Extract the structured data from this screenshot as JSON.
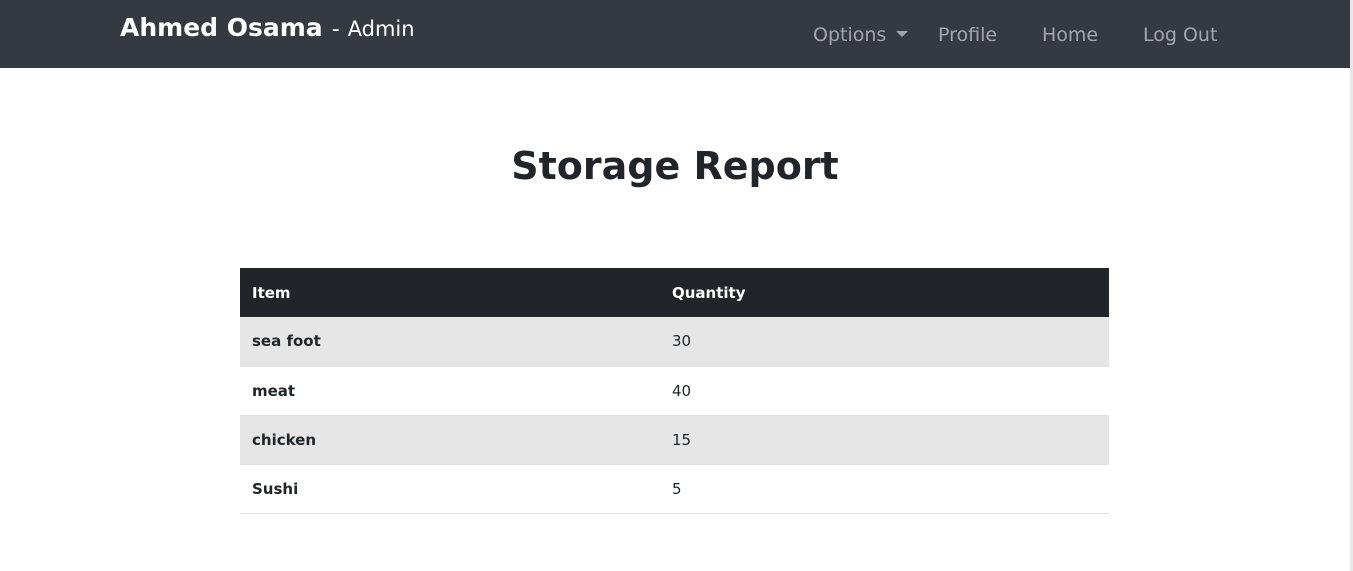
{
  "navbar": {
    "brand_name": "Ahmed Osama",
    "brand_separator": "-",
    "brand_role": "Admin",
    "options_label": "Options",
    "profile_label": "Profile",
    "home_label": "Home",
    "logout_label": "Log Out",
    "background_color": "#343a40"
  },
  "main": {
    "title": "Storage Report",
    "table": {
      "headers": [
        "Item",
        "Quantity"
      ],
      "rows": [
        {
          "item": "sea foot",
          "quantity": "30"
        },
        {
          "item": "meat",
          "quantity": "40"
        },
        {
          "item": "chicken",
          "quantity": "15"
        },
        {
          "item": "Sushi",
          "quantity": "5"
        }
      ],
      "header_color": "#212529",
      "stripe_color": "#e6e6e6"
    }
  }
}
